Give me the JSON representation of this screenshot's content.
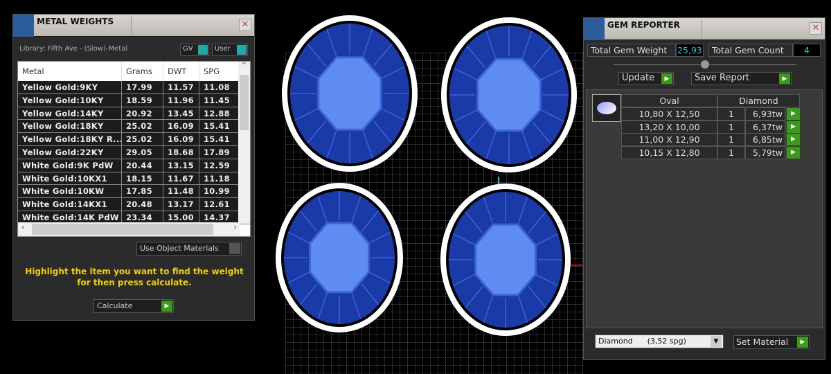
{
  "metal_weights": {
    "title": "METAL WEIGHTS",
    "library": "Library: Fifth Ave - (Slow)-Metal",
    "gv_label": "GV",
    "user_label": "User",
    "columns": [
      "Metal",
      "Grams",
      "DWT",
      "SPG"
    ],
    "rows": [
      [
        "Yellow Gold:9KY",
        "17.99",
        "11.57",
        "11.08"
      ],
      [
        "Yellow Gold:10KY",
        "18.59",
        "11.96",
        "11.45"
      ],
      [
        "Yellow Gold:14KY",
        "20.92",
        "13.45",
        "12.88"
      ],
      [
        "Yellow Gold:18KY",
        "25.02",
        "16.09",
        "15.41"
      ],
      [
        "Yellow Gold:18KY R...",
        "25.02",
        "16.09",
        "15.41"
      ],
      [
        "Yellow Gold:22KY",
        "29.05",
        "18.68",
        "17.89"
      ],
      [
        "White Gold:9K PdW",
        "20.44",
        "13.15",
        "12.59"
      ],
      [
        "White Gold:10KX1",
        "18.15",
        "11.67",
        "11.18"
      ],
      [
        "White Gold:10KW",
        "17.85",
        "11.48",
        "10.99"
      ],
      [
        "White Gold:14KX1",
        "20.48",
        "13.17",
        "12.61"
      ],
      [
        "White Gold:14K PdW",
        "23.34",
        "15.00",
        "14.37"
      ]
    ],
    "use_object_materials": "Use Object Materials",
    "hint_line1": "Highlight the item you want to find the weight",
    "hint_line2": "for then press calculate.",
    "calculate": "Calculate"
  },
  "gem_reporter": {
    "title": "GEM REPORTER",
    "total_weight_label": "Total Gem Weight",
    "total_weight": "25,93",
    "total_count_label": "Total Gem Count",
    "total_count": "4",
    "update": "Update",
    "save_report": "Save Report",
    "shape": "Oval",
    "material_header": "Diamond",
    "gems": [
      {
        "size": "10,80 X 12,50",
        "qty": "1",
        "weight": "6,93tw"
      },
      {
        "size": "13,20 X 10,00",
        "qty": "1",
        "weight": "6,37tw"
      },
      {
        "size": "11,00 X 12,90",
        "qty": "1",
        "weight": "6,85tw"
      },
      {
        "size": "10,15 X 12,80",
        "qty": "1",
        "weight": "5,79tw"
      }
    ],
    "material_select": "Diamond      (3,52 spg)",
    "set_material": "Set Material"
  },
  "colors": {
    "accent_green": "#3a9a1a",
    "readout_cyan": "#1ec8c8",
    "gem_blue": "#1a3aa8"
  }
}
